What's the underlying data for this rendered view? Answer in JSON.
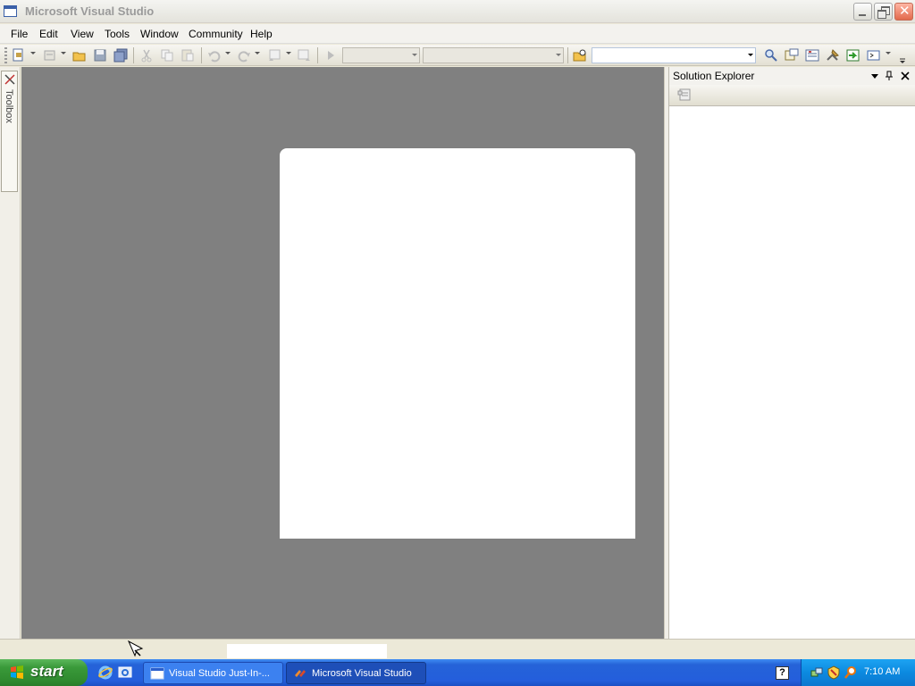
{
  "window": {
    "title": "Microsoft Visual Studio"
  },
  "menu": {
    "items": [
      "File",
      "Edit",
      "View",
      "Tools",
      "Window",
      "Community",
      "Help"
    ]
  },
  "toolbox": {
    "label": "Toolbox"
  },
  "solution_explorer": {
    "title": "Solution Explorer"
  },
  "taskbar": {
    "start_label": "start",
    "tasks": [
      {
        "label": "Visual Studio Just-In-..."
      },
      {
        "label": "Microsoft Visual Studio"
      }
    ],
    "help_glyph": "?",
    "clock": "7:10 AM"
  },
  "colors": {
    "document_background": "#808080",
    "taskbar_blue": "#245edc",
    "start_green": "#3a9a3a",
    "tray_blue": "#0c8ae0"
  },
  "icons": {
    "toolbar": [
      "new-project-icon",
      "add-item-icon",
      "open-file-icon",
      "save-icon",
      "save-all-icon",
      "cut-icon",
      "copy-icon",
      "paste-icon",
      "undo-icon",
      "redo-icon",
      "navigate-backward-icon",
      "navigate-forward-icon",
      "start-debugging-icon",
      "find-in-files-icon",
      "find-icon",
      "solution-explorer-icon",
      "properties-icon",
      "object-browser-icon",
      "toolbox-icon",
      "class-view-icon"
    ]
  }
}
